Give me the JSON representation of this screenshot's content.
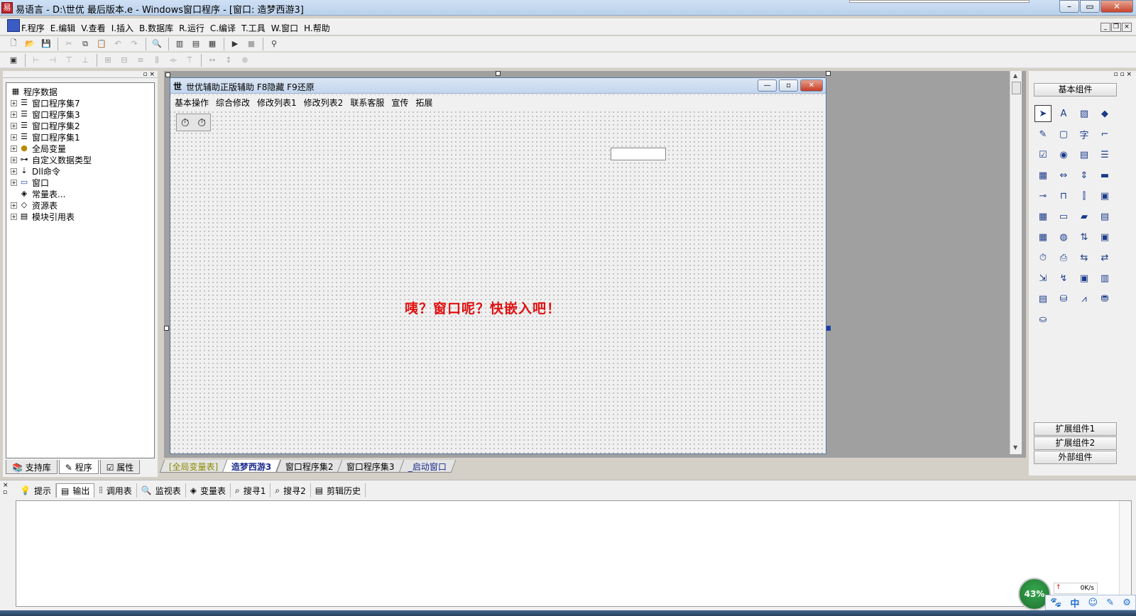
{
  "window": {
    "title": "易语言 - D:\\世优 最后版本.e - Windows窗口程序 - [窗口: 造梦西游3]",
    "icon": "app-logo-icon",
    "buttons": [
      "minimize-icon",
      "maximize-icon",
      "close-icon"
    ]
  },
  "menu": {
    "items": [
      "F.程序",
      "E.编辑",
      "V.查看",
      "I.插入",
      "B.数据库",
      "R.运行",
      "C.编译",
      "T.工具",
      "W.窗口",
      "H.帮助"
    ]
  },
  "left_panel": {
    "tree_root": "程序数据",
    "tree_items": [
      {
        "label": "窗口程序集7",
        "icon": "stack-icon"
      },
      {
        "label": "窗口程序集3",
        "icon": "stack-icon"
      },
      {
        "label": "窗口程序集2",
        "icon": "stack-icon"
      },
      {
        "label": "窗口程序集1",
        "icon": "stack-icon"
      },
      {
        "label": "全局变量",
        "icon": "jar-icon"
      },
      {
        "label": "自定义数据类型",
        "icon": "type-icon"
      },
      {
        "label": "Dll命令",
        "icon": "dll-icon"
      },
      {
        "label": "窗口",
        "icon": "window-icon"
      },
      {
        "label": "常量表...",
        "icon": "constant-icon"
      },
      {
        "label": "资源表",
        "icon": "resource-icon"
      },
      {
        "label": "模块引用表",
        "icon": "module-icon"
      }
    ],
    "tabs": [
      "支持库",
      "程序",
      "属性"
    ]
  },
  "design_form": {
    "title": "世优辅助正版辅助   F8隐藏  F9还原",
    "title_icon": "世",
    "menu": [
      "基本操作",
      "综合修改",
      "修改列表1",
      "修改列表2",
      "联系客服",
      "宣传",
      "拓展"
    ],
    "message": "咦？窗口呢？快嵌入吧！",
    "message_color": "#e01010"
  },
  "doc_tabs": [
    "[全局变量表]",
    "造梦西游3",
    "窗口程序集2",
    "窗口程序集3",
    "_启动窗口"
  ],
  "doc_tab_active": "造梦西游3",
  "toolbox": {
    "header": "基本组件",
    "groups": [
      "扩展组件1",
      "扩展组件2",
      "外部组件"
    ]
  },
  "bottom_panel": {
    "tabs": [
      {
        "label": "提示",
        "icon": "bulb-icon"
      },
      {
        "label": "输出",
        "icon": "doc-icon"
      },
      {
        "label": "调用表",
        "icon": "list-icon"
      },
      {
        "label": "监视表",
        "icon": "magnifier-icon"
      },
      {
        "label": "变量表",
        "icon": "vars-icon"
      },
      {
        "label": "搜寻1",
        "icon": "search-icon"
      },
      {
        "label": "搜寻2",
        "icon": "search-icon"
      },
      {
        "label": "剪辑历史",
        "icon": "clipboard-icon"
      }
    ],
    "active_tab": "输出"
  },
  "overlays": {
    "net_meter_percent": "43%",
    "net_speed": "0K/s",
    "ime_label": "中"
  }
}
